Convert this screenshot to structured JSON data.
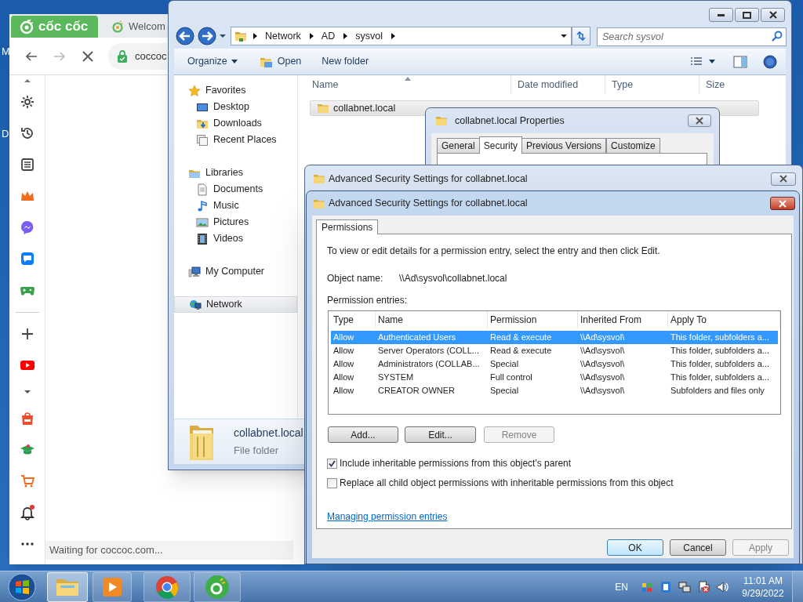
{
  "desktop": {
    "icon_labels": [
      "M",
      "D"
    ]
  },
  "browser": {
    "logo": "cốc cốc",
    "tab": "Welcom",
    "address": "coccoc",
    "status": "Waiting for coccoc.com..."
  },
  "explorer": {
    "breadcrumb": [
      "Network",
      "AD",
      "sysvol"
    ],
    "search": {
      "placeholder": "Search sysvol"
    },
    "toolbar": [
      {
        "label": "Organize",
        "kind": "menu"
      },
      {
        "label": "Open",
        "kind": "open"
      },
      {
        "label": "New folder",
        "kind": "plain"
      }
    ],
    "nav": [
      {
        "label": "Favorites",
        "kind": "star",
        "selected": false,
        "children": [
          {
            "label": "Desktop",
            "kind": "desktop",
            "selected": false
          },
          {
            "label": "Downloads",
            "kind": "downloads",
            "selected": false
          },
          {
            "label": "Recent Places",
            "kind": "recent",
            "selected": false
          }
        ]
      },
      {
        "label": "Libraries",
        "kind": "library",
        "selected": false,
        "children": [
          {
            "label": "Documents",
            "kind": "document",
            "selected": false
          },
          {
            "label": "Music",
            "kind": "music",
            "selected": false
          },
          {
            "label": "Pictures",
            "kind": "picture",
            "selected": false
          },
          {
            "label": "Videos",
            "kind": "video",
            "selected": false
          }
        ]
      },
      {
        "label": "My Computer",
        "kind": "computer",
        "selected": false
      },
      {
        "label": "Network",
        "kind": "network",
        "selected": true
      }
    ],
    "columns": [
      "Name",
      "Date modified",
      "Type",
      "Size"
    ],
    "files": [
      {
        "name": "collabnet.local",
        "selected": true
      }
    ],
    "details": {
      "name": "collabnet.local",
      "type": "File folder"
    }
  },
  "properties": {
    "title": "collabnet.local Properties",
    "tabs": [
      {
        "label": "General",
        "selected": false
      },
      {
        "label": "Security",
        "selected": true
      },
      {
        "label": "Previous Versions",
        "selected": false
      },
      {
        "label": "Customize",
        "selected": false
      }
    ]
  },
  "advanced_behind": {
    "title": "Advanced Security Settings for collabnet.local"
  },
  "advanced": {
    "title": "Advanced Security Settings for collabnet.local",
    "tabs": [
      {
        "label": "Permissions",
        "selected": true
      }
    ],
    "intro": "To view or edit details for a permission entry, select the entry and then click Edit.",
    "object_label": "Object name:",
    "object_name": "\\\\Ad\\sysvol\\collabnet.local",
    "entries_label": "Permission entries:",
    "columns": [
      "Type",
      "Name",
      "Permission",
      "Inherited From",
      "Apply To"
    ],
    "rows": [
      {
        "type": "Allow",
        "name": "Authenticated Users",
        "permission": "Read & execute",
        "inherited_from": "\\\\Ad\\sysvol\\",
        "apply_to": "This folder, subfolders a...",
        "selected": true
      },
      {
        "type": "Allow",
        "name": "Server Operators (COLL...",
        "permission": "Read & execute",
        "inherited_from": "\\\\Ad\\sysvol\\",
        "apply_to": "This folder, subfolders a...",
        "selected": false
      },
      {
        "type": "Allow",
        "name": "Administrators (COLLAB...",
        "permission": "Special",
        "inherited_from": "\\\\Ad\\sysvol\\",
        "apply_to": "This folder, subfolders a...",
        "selected": false
      },
      {
        "type": "Allow",
        "name": "SYSTEM",
        "permission": "Full control",
        "inherited_from": "\\\\Ad\\sysvol\\",
        "apply_to": "This folder, subfolders a...",
        "selected": false
      },
      {
        "type": "Allow",
        "name": "CREATOR OWNER",
        "permission": "Special",
        "inherited_from": "\\\\Ad\\sysvol\\",
        "apply_to": "Subfolders and files only",
        "selected": false
      }
    ],
    "buttons": [
      {
        "label": "Add...",
        "disabled": false
      },
      {
        "label": "Edit...",
        "disabled": false
      },
      {
        "label": "Remove",
        "disabled": true
      }
    ],
    "checkboxes": [
      {
        "label": "Include inheritable permissions from this object's parent",
        "checked": true
      },
      {
        "label": "Replace all child object permissions with inheritable permissions from this object",
        "checked": false
      }
    ],
    "link": "Managing permission entries",
    "footer_buttons": [
      {
        "label": "OK",
        "default": true,
        "disabled": false
      },
      {
        "label": "Cancel",
        "default": false,
        "disabled": false
      },
      {
        "label": "Apply",
        "default": false,
        "disabled": true
      }
    ]
  },
  "taskbar": {
    "items": [
      {
        "kind": "explorer",
        "selected": true
      },
      {
        "kind": "media",
        "selected": false
      },
      {
        "kind": "chrome",
        "selected": false
      },
      {
        "kind": "coccoc",
        "selected": false
      }
    ],
    "language": "EN",
    "time": "11:01 AM",
    "date": "9/29/2022"
  }
}
